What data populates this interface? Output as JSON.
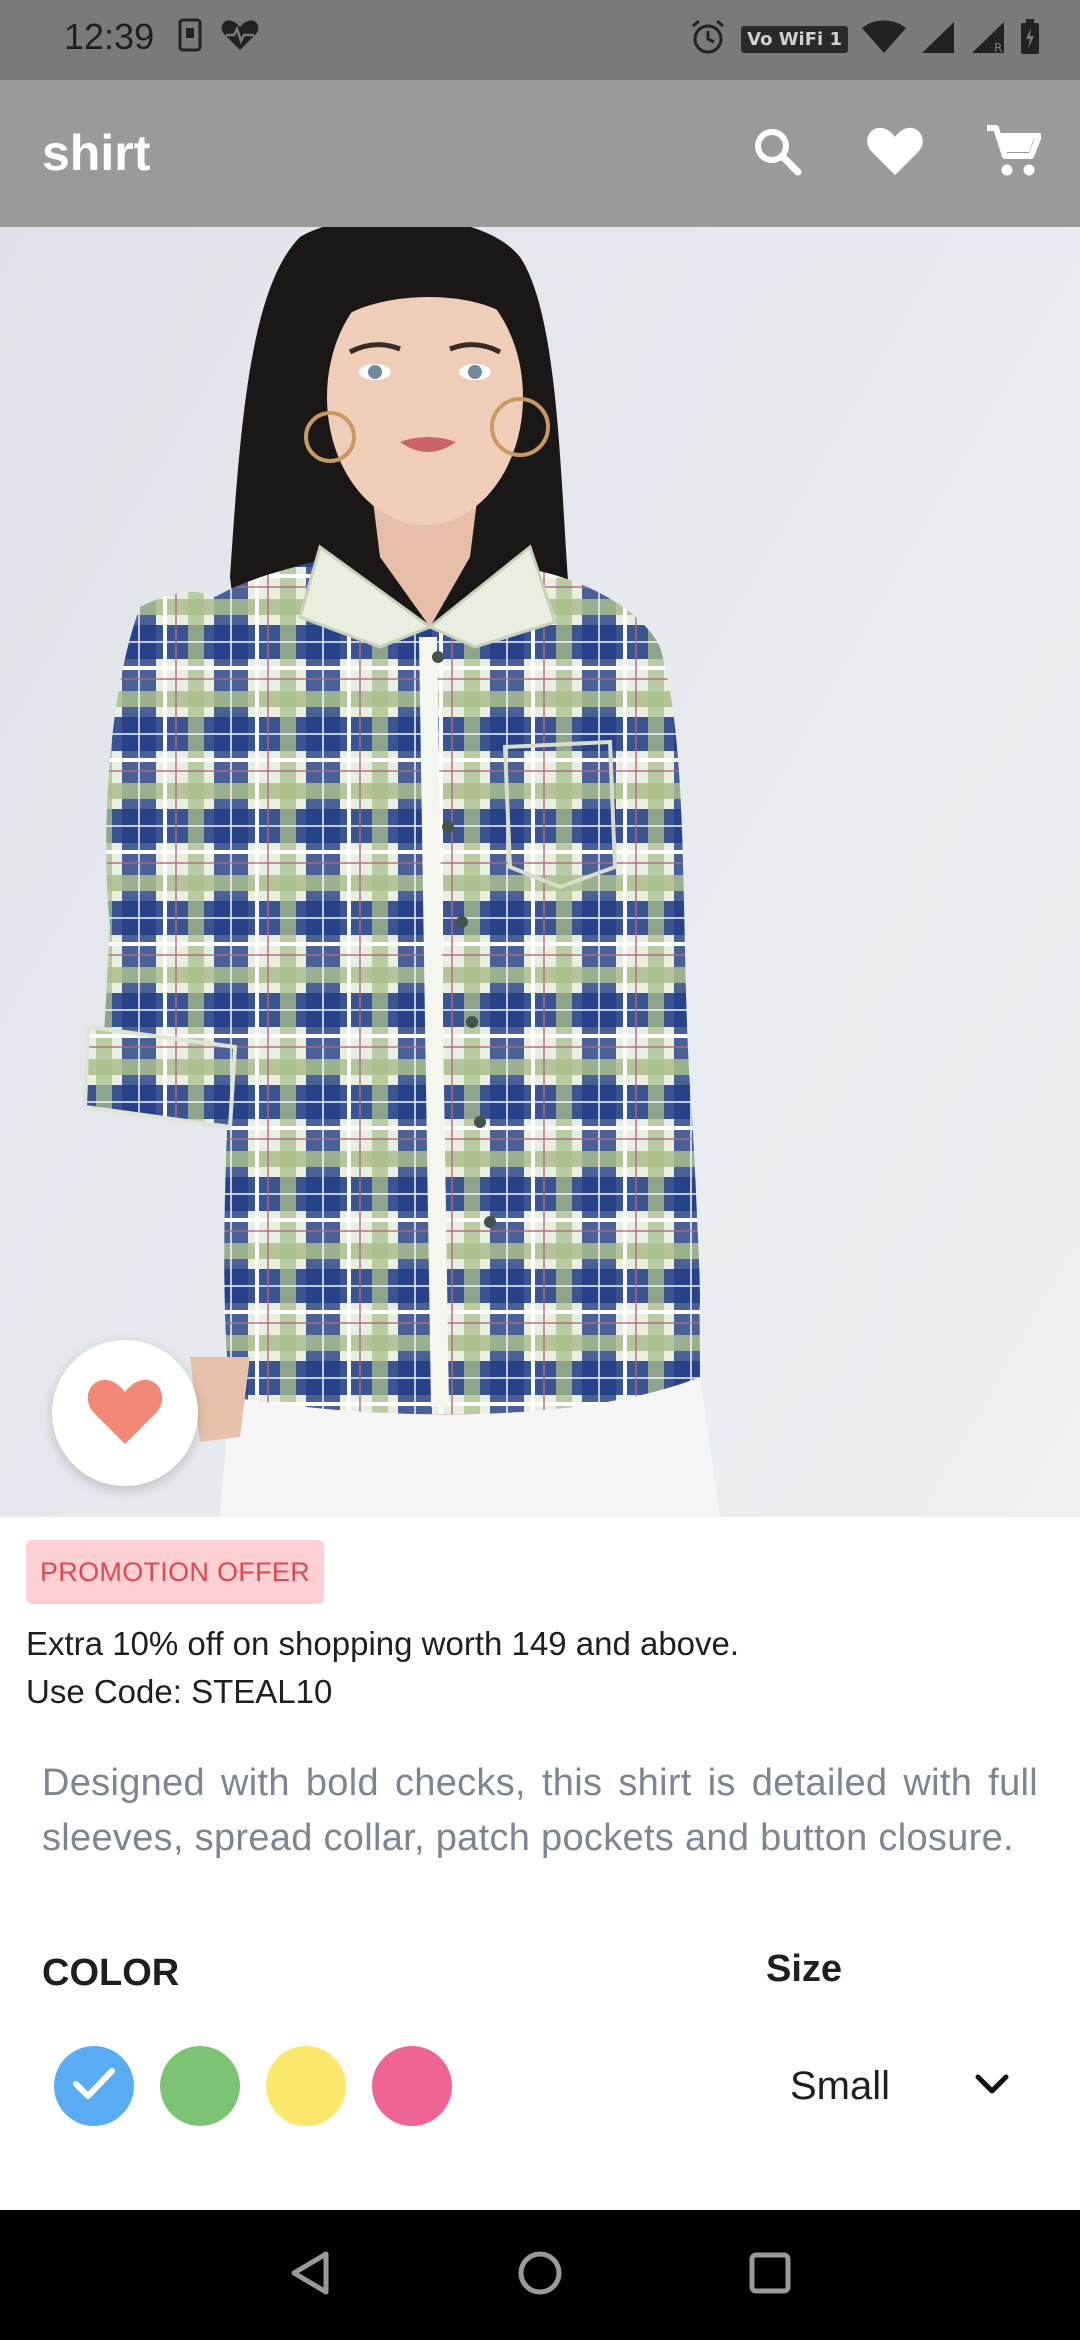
{
  "status_bar": {
    "time": "12:39",
    "wifi_label": "Vo WiFi 1",
    "icons": [
      "sim-card-icon",
      "heart-rate-icon",
      "alarm-icon",
      "wifi-icon",
      "signal-icon",
      "signal-roaming-icon",
      "battery-icon"
    ]
  },
  "app_bar": {
    "title": "shirt",
    "actions": [
      "search-icon",
      "heart-icon",
      "cart-icon"
    ]
  },
  "hero": {
    "background": "#e5e8ed"
  },
  "promo": {
    "badge": "PROMOTION OFFER",
    "line1": "Extra 10% off on shopping worth 149 and above.",
    "line2": "Use Code: STEAL10"
  },
  "product": {
    "description": "Designed with bold checks, this shirt is detailed with full sleeves, spread collar, patch pockets and button closure."
  },
  "color": {
    "label": "COLOR",
    "selected": 0,
    "swatches": [
      "#5aacf2",
      "#7cc474",
      "#fbe86a",
      "#ef6496"
    ]
  },
  "size": {
    "label": "Size",
    "value": "Small"
  },
  "colors": {
    "status_bar": "#7a7a7a",
    "app_bar": "#9a9a9a",
    "favorite": "#f08a76",
    "promo_bg": "#fdd0d3",
    "promo_fg": "#e0474f",
    "description": "#7c8592"
  }
}
